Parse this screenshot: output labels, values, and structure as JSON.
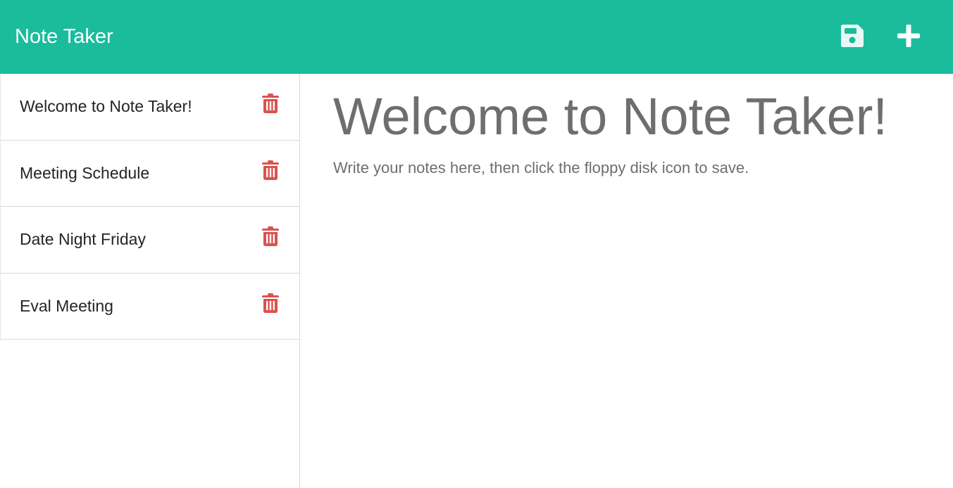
{
  "navbar": {
    "brand": "Note Taker",
    "background_color": "#1abc9c",
    "save_icon": "floppy-disk-icon",
    "new_icon": "plus-icon"
  },
  "sidebar": {
    "delete_icon": "trash-icon",
    "delete_color": "#d9534f",
    "notes": [
      {
        "title": "Welcome to Note Taker!"
      },
      {
        "title": "Meeting Schedule"
      },
      {
        "title": "Date Night Friday"
      },
      {
        "title": "Eval Meeting"
      }
    ]
  },
  "main": {
    "note_title": "Welcome to Note Taker!",
    "note_text": "Write your notes here, then click the floppy disk icon to save."
  }
}
